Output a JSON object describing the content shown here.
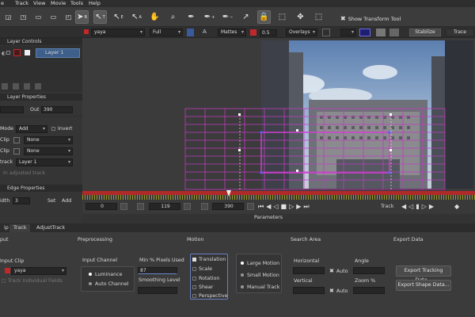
{
  "menu": [
    "e",
    "Track",
    "View",
    "Movie",
    "Tools",
    "Help"
  ],
  "toolbar": {
    "tools": [
      {
        "name": "select-tool",
        "glyph": "➤",
        "sup": "B",
        "active": true
      },
      {
        "name": "transform-tool",
        "glyph": "↖",
        "sup": "T",
        "active": true
      },
      {
        "name": "edge-tool",
        "glyph": "↖",
        "sup": "E",
        "active": false
      },
      {
        "name": "edge2-tool",
        "glyph": "↖",
        "sup": "A",
        "active": false
      },
      {
        "name": "hand-tool",
        "glyph": "✋",
        "sup": "",
        "active": false
      },
      {
        "name": "zoom-tool",
        "glyph": "⌕",
        "sup": "",
        "active": false
      },
      {
        "name": "add-point-tool",
        "glyph": "✒",
        "sup": "",
        "active": false
      },
      {
        "name": "add-point2-tool",
        "glyph": "✒",
        "sup": "+",
        "active": false
      },
      {
        "name": "remove-point-tool",
        "glyph": "✒",
        "sup": "−",
        "active": false
      },
      {
        "name": "convert-point-tool",
        "glyph": "↗",
        "sup": "",
        "active": false
      },
      {
        "name": "lock-tool",
        "glyph": "🔒",
        "sup": "",
        "active": true
      },
      {
        "name": "transform-box-tool",
        "glyph": "⬚",
        "sup": "",
        "active": false
      },
      {
        "name": "anchor-tool",
        "glyph": "✥",
        "sup": "",
        "active": false
      },
      {
        "name": "hierarchy-tool",
        "glyph": "⬚",
        "sup": "",
        "active": false
      }
    ],
    "show_transform": "Show Transform Tool"
  },
  "row2": {
    "layer": "yaya",
    "zoom": "Full",
    "mattes": "Mattes",
    "opacity": "0.5",
    "overlays": "Overlays",
    "stabilize": "Stabilize",
    "trace": "Trace"
  },
  "left": {
    "layer_controls": "Layer Controls",
    "layer_name": "Layer 1",
    "layer_properties": "Layer Properties",
    "out_label": "Out",
    "out_value": "390",
    "mode_label": "Mode",
    "mode_value": "Add",
    "invert_label": "Invert",
    "clip1_label": "Clip",
    "clip1_value": "None",
    "clip2_label": "Clip",
    "clip2_value": "None",
    "track_label": "track",
    "track_value": "Layer 1",
    "adjusted_track": "In adjusted track",
    "edge_properties": "Edge Properties",
    "width_label": "idth",
    "width_value": "3",
    "set_label": "Set",
    "add_label": "Add"
  },
  "timeline": {
    "start": "0",
    "in_frame": "119",
    "out_frame": "390",
    "track_label": "Track",
    "parameters": "Parameters"
  },
  "tabs": [
    "ip",
    "Track",
    "AdjustTrack"
  ],
  "bottom": {
    "input_header": "put",
    "input_clip_label": "Input Clip",
    "input_clip_value": "yaya",
    "track_individual": "Track Individual Fields",
    "preprocessing": "Preprocessing",
    "input_channel": "Input Channel",
    "luminance": "Luminance",
    "auto_channel": "Auto Channel",
    "min_pixels": "Min % Pixels Used",
    "min_pixels_value": "87",
    "smoothing": "Smoothing Level",
    "motion": "Motion",
    "translation": "Translation",
    "scale": "Scale",
    "rotation": "Rotation",
    "shear": "Shear",
    "perspective": "Perspective",
    "large_motion": "Large Motion",
    "small_motion": "Small Motion",
    "manual_track": "Manual Track",
    "search_area": "Search Area",
    "horizontal": "Horizontal",
    "vertical": "Vertical",
    "auto1": "Auto",
    "auto2": "Auto",
    "export_data": "Export Data",
    "angle": "Angle",
    "zoom_pct": "Zoom %",
    "export_tracking": "Export Tracking Data...",
    "export_shape": "Export Shape Data..."
  }
}
